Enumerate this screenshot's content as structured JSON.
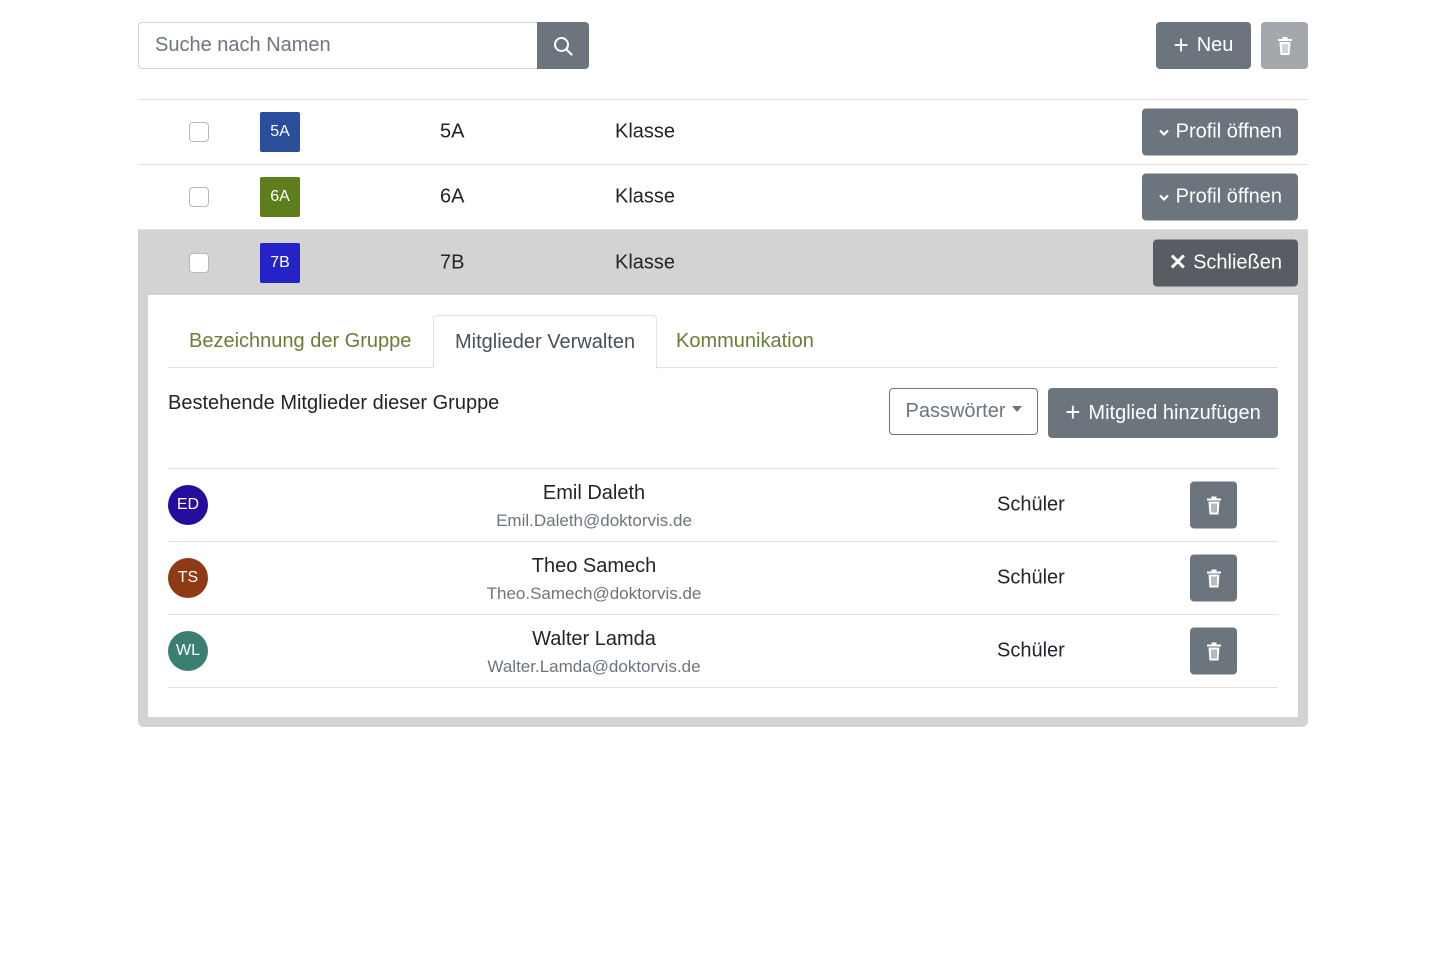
{
  "search": {
    "placeholder": "Suche nach Namen"
  },
  "toolbar": {
    "new_label": "Neu"
  },
  "groups": [
    {
      "badge": "5A",
      "badge_color": "#2a4d9c",
      "name": "5A",
      "type": "Klasse",
      "action": "Profil öffnen"
    },
    {
      "badge": "6A",
      "badge_color": "#5e7d1c",
      "name": "6A",
      "type": "Klasse",
      "action": "Profil öffnen"
    },
    {
      "badge": "7B",
      "badge_color": "#2323c8",
      "name": "7B",
      "type": "Klasse",
      "action": "Schließen"
    }
  ],
  "detail": {
    "tabs": [
      {
        "label": "Bezeichnung der Gruppe",
        "active": false
      },
      {
        "label": "Mitglieder Verwalten",
        "active": true
      },
      {
        "label": "Kommunikation",
        "active": false
      }
    ],
    "heading": "Bestehende Mitglieder dieser Gruppe",
    "passwords_label": "Passwörter",
    "add_member_label": "Mitglied hinzufügen",
    "members": [
      {
        "initials": "ED",
        "avatar_color": "#260c9a",
        "name": "Emil Daleth",
        "email": "Emil.Daleth@doktorvis.de",
        "role": "Schüler"
      },
      {
        "initials": "TS",
        "avatar_color": "#8f3a14",
        "name": "Theo Samech",
        "email": "Theo.Samech@doktorvis.de",
        "role": "Schüler"
      },
      {
        "initials": "WL",
        "avatar_color": "#3b7f72",
        "name": "Walter Lamda",
        "email": "Walter.Lamda@doktorvis.de",
        "role": "Schüler"
      }
    ]
  },
  "colors": {
    "button_secondary": "#6c757d",
    "tab_link": "#6b7c3a",
    "active_row_bg": "#d3d3d3"
  }
}
